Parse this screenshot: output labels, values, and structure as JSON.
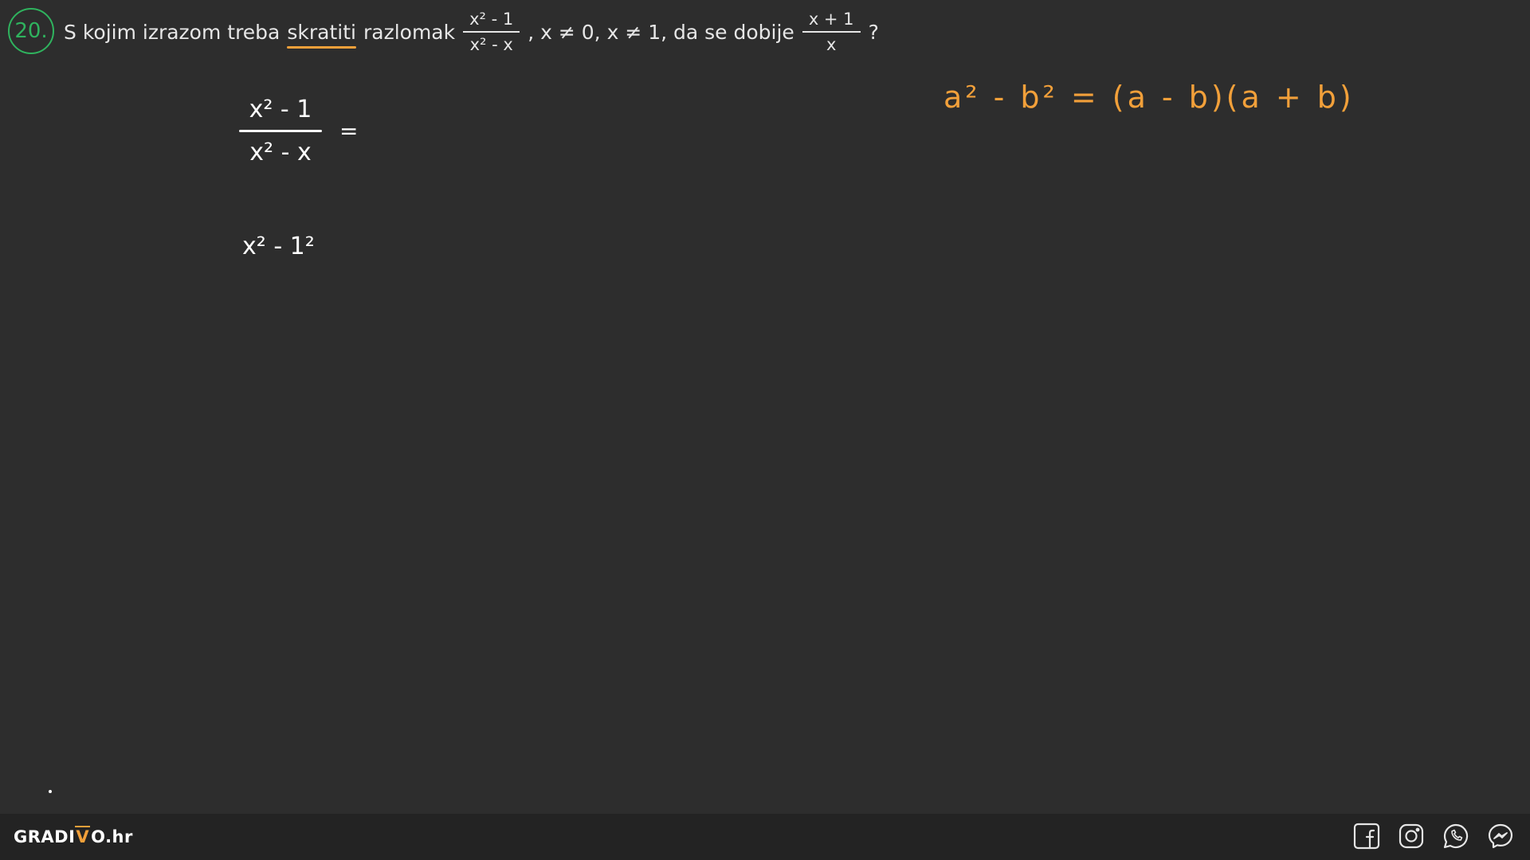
{
  "task": {
    "number": "20.",
    "text_before": "S kojim izrazom treba",
    "underlined_word": "skratiti",
    "text_mid": "razlomak",
    "fraction1": {
      "numerator": "x² - 1",
      "denominator": "x² - x"
    },
    "conditions": ", x ≠ 0, x ≠ 1, da se dobije",
    "fraction2": {
      "numerator": "x + 1",
      "denominator": "x"
    },
    "question_mark": "?"
  },
  "work": {
    "fraction": {
      "numerator": "x² - 1",
      "denominator": "x² - x"
    },
    "equals": "=",
    "line2": "x² - 1²"
  },
  "identity": "a² - b² = (a - b)(a + b)",
  "footer": {
    "logo_left": "GRADI",
    "logo_root": "V",
    "logo_right": "O.hr"
  },
  "colors": {
    "background": "#2d2d2d",
    "accent_orange": "#f2a03a",
    "number_green": "#2fb35e"
  },
  "icons": [
    "facebook-icon",
    "instagram-icon",
    "whatsapp-icon",
    "messenger-icon"
  ]
}
